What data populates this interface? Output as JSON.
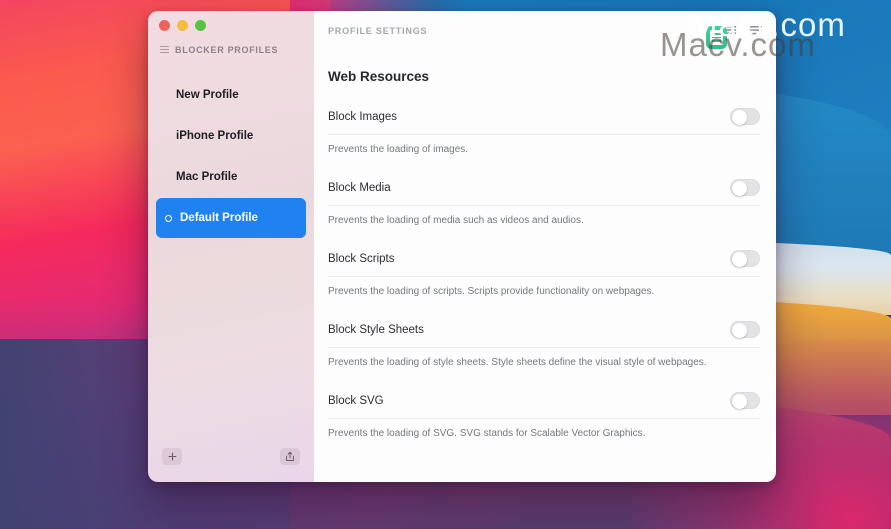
{
  "desktop": {
    "wallpaper_name": "big-sur-wallpaper",
    "colors": {
      "sky_blue": "#1877b8",
      "haze": "#dbe6ef",
      "orange": "#f0a13a",
      "red_pink": "#e0307a",
      "left_magenta": "#f52a5c",
      "bottom_purple": "#3b4a7a"
    }
  },
  "window": {
    "traffic_lights": [
      {
        "name": "close",
        "color": "#f0635a"
      },
      {
        "name": "minimize",
        "color": "#f3bc3f"
      },
      {
        "name": "zoom",
        "color": "#5ac241"
      }
    ],
    "sidebar": {
      "header_title": "BLOCKER PROFILES",
      "items": [
        {
          "label": "New Profile",
          "selected": false
        },
        {
          "label": "iPhone Profile",
          "selected": false
        },
        {
          "label": "Mac Profile",
          "selected": false
        },
        {
          "label": "Default Profile",
          "selected": true
        }
      ],
      "footer": {
        "add_label": "+",
        "share_label": "Share"
      },
      "selected_color": "#1f82f0"
    },
    "content": {
      "toolbar_title": "PROFILE SETTINGS",
      "toolbar_icons": [
        "list-view-icon",
        "filter-icon"
      ],
      "section_heading": "Web Resources",
      "settings": [
        {
          "label": "Block Images",
          "description": "Prevents the loading of images.",
          "toggle_on": false
        },
        {
          "label": "Block Media",
          "description": "Prevents the loading of media such as videos and audios.",
          "toggle_on": false
        },
        {
          "label": "Block Scripts",
          "description": "Prevents the loading of scripts. Scripts provide functionality on webpages.",
          "toggle_on": false
        },
        {
          "label": "Block Style Sheets",
          "description": "Prevents the loading of style sheets. Style sheets define the visual style of webpages.",
          "toggle_on": false
        },
        {
          "label": "Block SVG",
          "description": "Prevents the loading of SVG. SVG stands for Scalable Vector Graphics.",
          "toggle_on": false
        }
      ]
    }
  },
  "watermarks": {
    "primary": "Macv.com",
    "secondary": "Macv.com"
  }
}
